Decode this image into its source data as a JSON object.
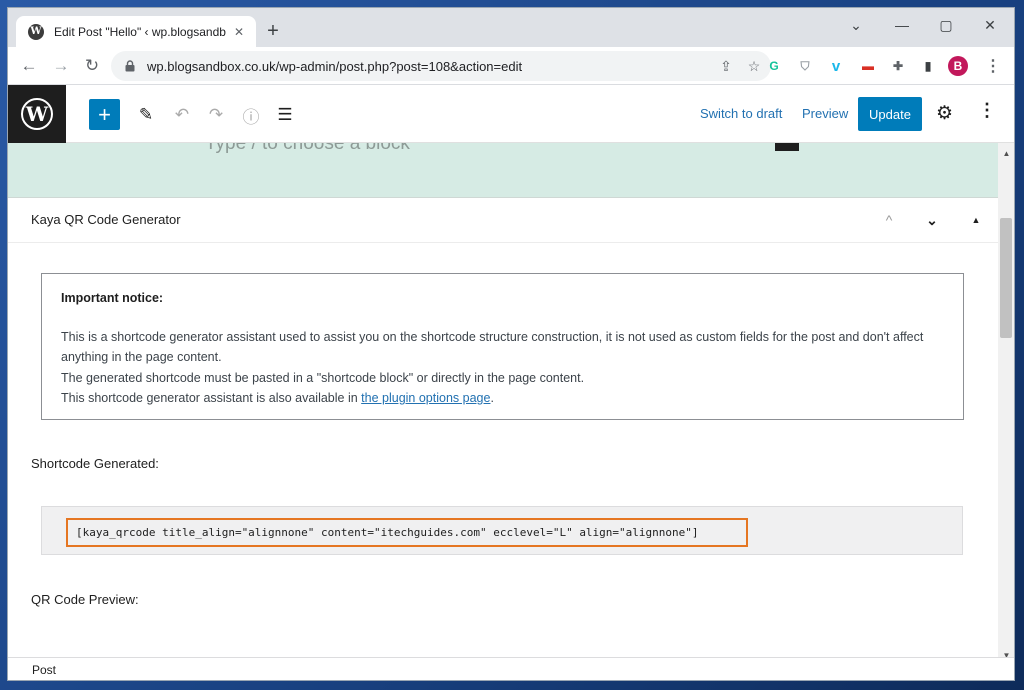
{
  "browser": {
    "tab_title": "Edit Post \"Hello\" ‹ wp.blogsandbox",
    "tab_close": "✕",
    "new_tab": "+",
    "favicon": "W",
    "url": "wp.blogsandbox.co.uk/wp-admin/post.php?post=108&action=edit",
    "window_controls": {
      "minimize": "—",
      "maximize": "▢",
      "close": "✕",
      "list": "⌄"
    },
    "nav": {
      "back": "←",
      "forward": "→",
      "reload": "↻"
    },
    "omnibox_icons": {
      "share": "⇪",
      "star": "☆"
    },
    "extensions": [
      {
        "name": "grammarly-icon",
        "glyph": "G",
        "color": "#15c39a"
      },
      {
        "name": "shield-extension-icon",
        "glyph": "⛉",
        "color": "#9aa0a6"
      },
      {
        "name": "vimeo-icon",
        "glyph": "v",
        "color": "#1ab7ea"
      },
      {
        "name": "screen-recorder-icon",
        "glyph": "▬",
        "color": "#d93025"
      },
      {
        "name": "puzzle-icon",
        "glyph": "✚",
        "color": "#5f6368"
      },
      {
        "name": "sidepanel-icon",
        "glyph": "▮",
        "color": "#3c4043"
      }
    ],
    "profile_initial": "B",
    "profile_color": "#c2185b",
    "menu": "⋮"
  },
  "editor": {
    "logo": "W",
    "inserter": "+",
    "tools": {
      "edit": "✎",
      "undo": "↶",
      "redo": "↷",
      "info": "ⓘ",
      "outline": "☰"
    },
    "switch_to_draft": "Switch to draft",
    "preview": "Preview",
    "update": "Update",
    "settings": "⚙",
    "options": "⋮",
    "accent": "#007cba"
  },
  "content": {
    "block_hint": "Type / to choose a block",
    "panel": {
      "title": "Kaya QR Code Generator",
      "move_up": "^",
      "move_down": "⌄",
      "toggle": "▲"
    },
    "notice": {
      "title": "Important notice:",
      "line1": "This is a shortcode generator assistant used to assist you on the shortcode structure construction, it is not used as custom fields for the post and don't affect anything in the page content.",
      "line2": "The generated shortcode must be pasted in a \"shortcode block\" or directly in the page content.",
      "line3_prefix": "This shortcode generator assistant is also available in ",
      "line3_link": "the plugin options page",
      "line3_suffix": "."
    },
    "shortcode_label": "Shortcode Generated:",
    "shortcode": "[kaya_qrcode title_align=\"alignnone\" content=\"itechguides.com\" ecclevel=\"L\" align=\"alignnone\"]",
    "highlight_color": "#e57622",
    "preview_label": "QR Code Preview:"
  },
  "scrollbar": {
    "up": "▲",
    "down": "▼"
  },
  "footer": {
    "breadcrumb": "Post"
  }
}
